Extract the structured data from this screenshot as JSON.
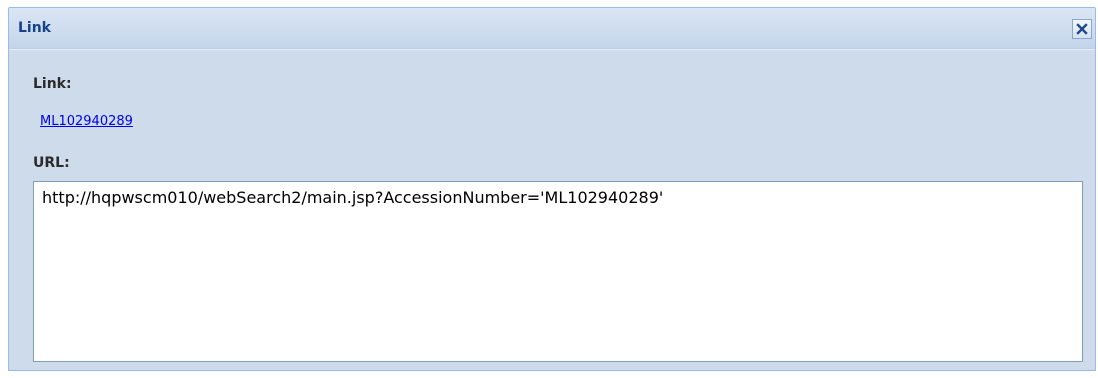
{
  "dialog": {
    "title": "Link",
    "close_icon": "close-icon"
  },
  "form": {
    "link_label": "Link:",
    "link_value": "ML102940289",
    "url_label": "URL:",
    "url_value": "http://hqpwscm010/webSearch2/main.jsp?AccessionNumber='ML102940289'"
  },
  "colors": {
    "header_text": "#15428b",
    "dialog_background": "#cedbeb",
    "border": "#99bbe8",
    "link": "#0000ee"
  }
}
